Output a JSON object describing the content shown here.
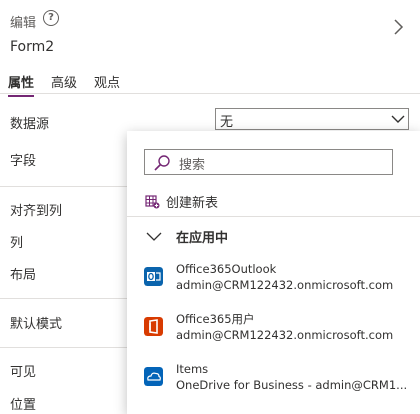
{
  "header": {
    "label": "编辑",
    "help_icon": "?",
    "form_name": "Form2"
  },
  "tabs": [
    {
      "label": "属性",
      "active": true
    },
    {
      "label": "高级",
      "active": false
    },
    {
      "label": "观点",
      "active": false
    }
  ],
  "properties": {
    "datasource": "数据源",
    "fields": "字段",
    "snap_to_columns": "对齐到列",
    "columns": "列",
    "layout": "布局",
    "default_mode": "默认模式",
    "visible": "可见",
    "position": "位置"
  },
  "datasource_select": {
    "value": "无"
  },
  "dropdown": {
    "search_placeholder": "搜索",
    "create_new_table": "创建新表",
    "group_label": "在应用中",
    "items": [
      {
        "title": "Office365Outlook",
        "subtitle": "admin@CRM122432.onmicrosoft.com",
        "icon": "outlook-icon",
        "color": "#0a64ad"
      },
      {
        "title": "Office365用户",
        "subtitle": "admin@CRM122432.onmicrosoft.com",
        "icon": "office-icon",
        "color": "#d83b01"
      },
      {
        "title": "Items",
        "subtitle": "OneDrive for Business - admin@CRM1...",
        "icon": "onedrive-icon",
        "color": "#0364b8"
      }
    ]
  },
  "colors": {
    "accent": "#742774"
  }
}
